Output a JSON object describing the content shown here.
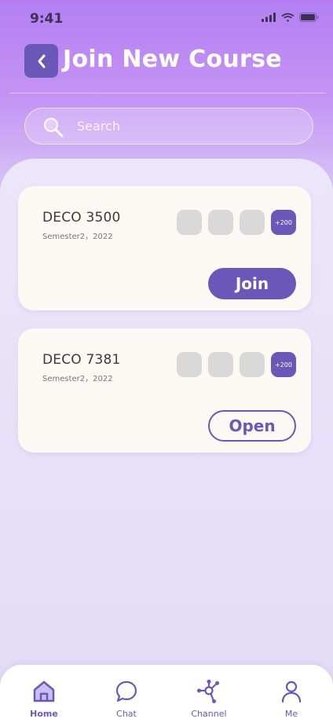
{
  "status_bar": {
    "time": "9:41"
  },
  "header": {
    "title": "Join New Course"
  },
  "search": {
    "placeholder": "Search"
  },
  "courses": [
    {
      "name": "DECO 3500",
      "semester": "Semester2，2022",
      "member_count": "+200",
      "action": "Join"
    },
    {
      "name": "DECO 7381",
      "semester": "Semester2，2022",
      "member_count": "+200",
      "action": "Open"
    }
  ],
  "nav": [
    {
      "label": "Home",
      "icon": "home-icon",
      "active": true
    },
    {
      "label": "Chat",
      "icon": "chat-icon",
      "active": false
    },
    {
      "label": "Channel",
      "icon": "channel-icon",
      "active": false
    },
    {
      "label": "Me",
      "icon": "user-icon",
      "active": false
    }
  ],
  "colors": {
    "accent": "#6a58b9",
    "gradient_top": "#b47ef2",
    "card": "#fcf9f4"
  }
}
